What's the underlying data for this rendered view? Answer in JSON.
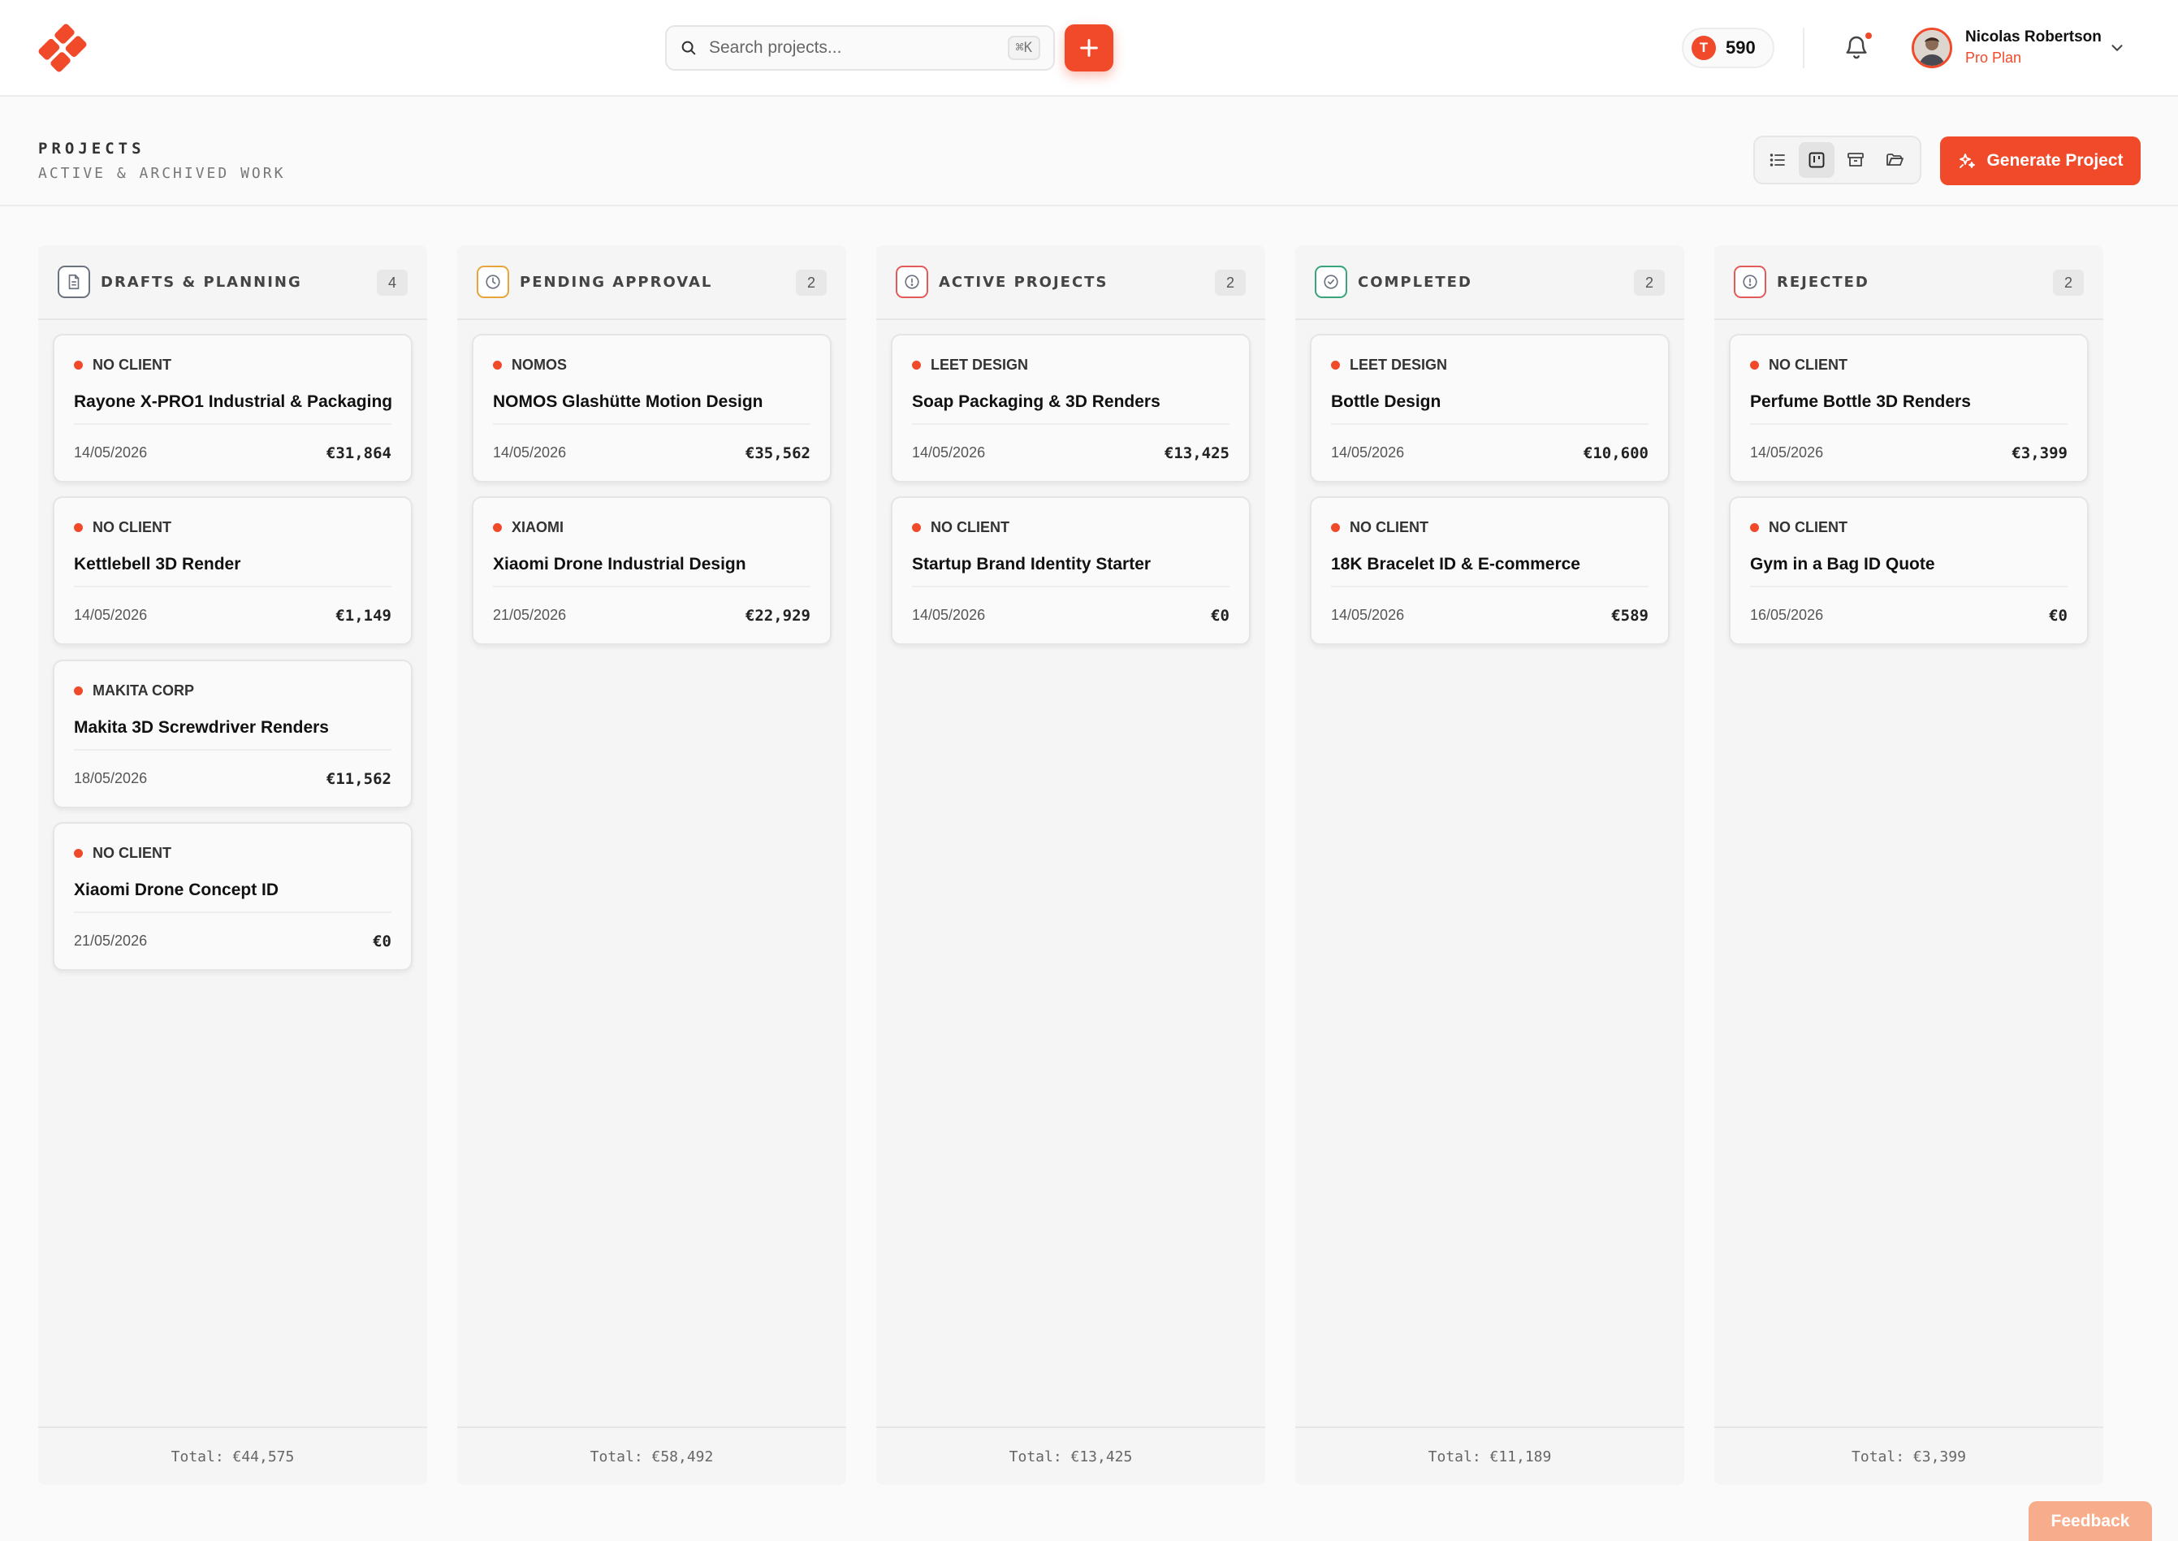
{
  "header": {
    "search_placeholder": "Search projects...",
    "search_shortcut": "⌘K",
    "credits": "590",
    "credit_icon_letter": "T",
    "user": {
      "name": "Nicolas Robertson",
      "plan": "Pro Plan"
    }
  },
  "page": {
    "title": "PROJECTS",
    "subtitle": "ACTIVE & ARCHIVED WORK",
    "generate_label": "Generate Project"
  },
  "colors": {
    "accent": "#f04a2b",
    "amber": "#e8a53a",
    "green": "#3aa57a",
    "red": "#e25a5a",
    "slate": "#6b7280"
  },
  "columns": [
    {
      "title": "DRAFTS & PLANNING",
      "count": "4",
      "icon": "document-icon",
      "total": "Total: €44,575",
      "cards": [
        {
          "client": "NO CLIENT",
          "title": "Rayone X-PRO1 Industrial & Packaging",
          "date": "14/05/2026",
          "value": "€31,864"
        },
        {
          "client": "NO CLIENT",
          "title": "Kettlebell 3D Render",
          "date": "14/05/2026",
          "value": "€1,149"
        },
        {
          "client": "MAKITA CORP",
          "title": "Makita 3D Screwdriver Renders",
          "date": "18/05/2026",
          "value": "€11,562"
        },
        {
          "client": "NO CLIENT",
          "title": "Xiaomi Drone Concept ID",
          "date": "21/05/2026",
          "value": "€0"
        }
      ]
    },
    {
      "title": "PENDING APPROVAL",
      "count": "2",
      "icon": "clock-icon",
      "total": "Total: €58,492",
      "cards": [
        {
          "client": "NOMOS",
          "title": "NOMOS Glashütte Motion Design",
          "date": "14/05/2026",
          "value": "€35,562"
        },
        {
          "client": "XIAOMI",
          "title": "Xiaomi Drone Industrial Design",
          "date": "21/05/2026",
          "value": "€22,929"
        }
      ]
    },
    {
      "title": "ACTIVE PROJECTS",
      "count": "2",
      "icon": "info-icon",
      "total": "Total: €13,425",
      "cards": [
        {
          "client": "LEET DESIGN",
          "title": "Soap Packaging & 3D Renders",
          "date": "14/05/2026",
          "value": "€13,425"
        },
        {
          "client": "NO CLIENT",
          "title": "Startup Brand Identity Starter",
          "date": "14/05/2026",
          "value": "€0"
        }
      ]
    },
    {
      "title": "COMPLETED",
      "count": "2",
      "icon": "check-circle-icon",
      "total": "Total: €11,189",
      "cards": [
        {
          "client": "LEET DESIGN",
          "title": "Bottle Design",
          "date": "14/05/2026",
          "value": "€10,600"
        },
        {
          "client": "NO CLIENT",
          "title": "18K Bracelet ID & E-commerce",
          "date": "14/05/2026",
          "value": "€589"
        }
      ]
    },
    {
      "title": "REJECTED",
      "count": "2",
      "icon": "alert-circle-icon",
      "total": "Total: €3,399",
      "cards": [
        {
          "client": "NO CLIENT",
          "title": "Perfume Bottle 3D Renders",
          "date": "14/05/2026",
          "value": "€3,399"
        },
        {
          "client": "NO CLIENT",
          "title": "Gym in a Bag ID Quote",
          "date": "16/05/2026",
          "value": "€0"
        }
      ]
    }
  ],
  "feedback_label": "Feedback"
}
